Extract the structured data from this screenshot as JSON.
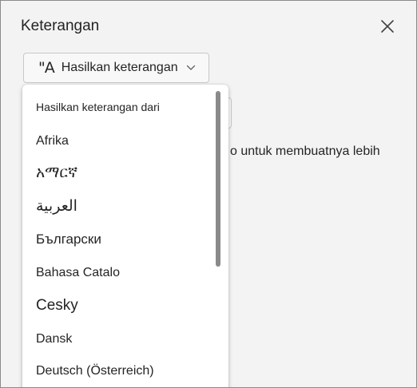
{
  "panel": {
    "title": "Keterangan",
    "close_icon": "close-icon"
  },
  "generate_button": {
    "icon_text": "\"A",
    "label": "Hasilkan keterangan",
    "chevron_icon": "chevron-down-icon"
  },
  "background": {
    "partial_text": "o untuk membuatnya lebih"
  },
  "dropdown": {
    "header": "Hasilkan keterangan dari",
    "options": [
      {
        "label": "Afrika"
      },
      {
        "label": "አማርኛ"
      },
      {
        "label": "العربية"
      },
      {
        "label": "Български"
      },
      {
        "label": "Bahasa Catalo"
      },
      {
        "label": "Cesky"
      },
      {
        "label": "Dansk"
      },
      {
        "label": "Deutsch (Österreich)"
      }
    ]
  },
  "colors": {
    "panel_bg": "#f3f3f3",
    "text": "#242424",
    "scrollbar": "#8a8a8a"
  }
}
